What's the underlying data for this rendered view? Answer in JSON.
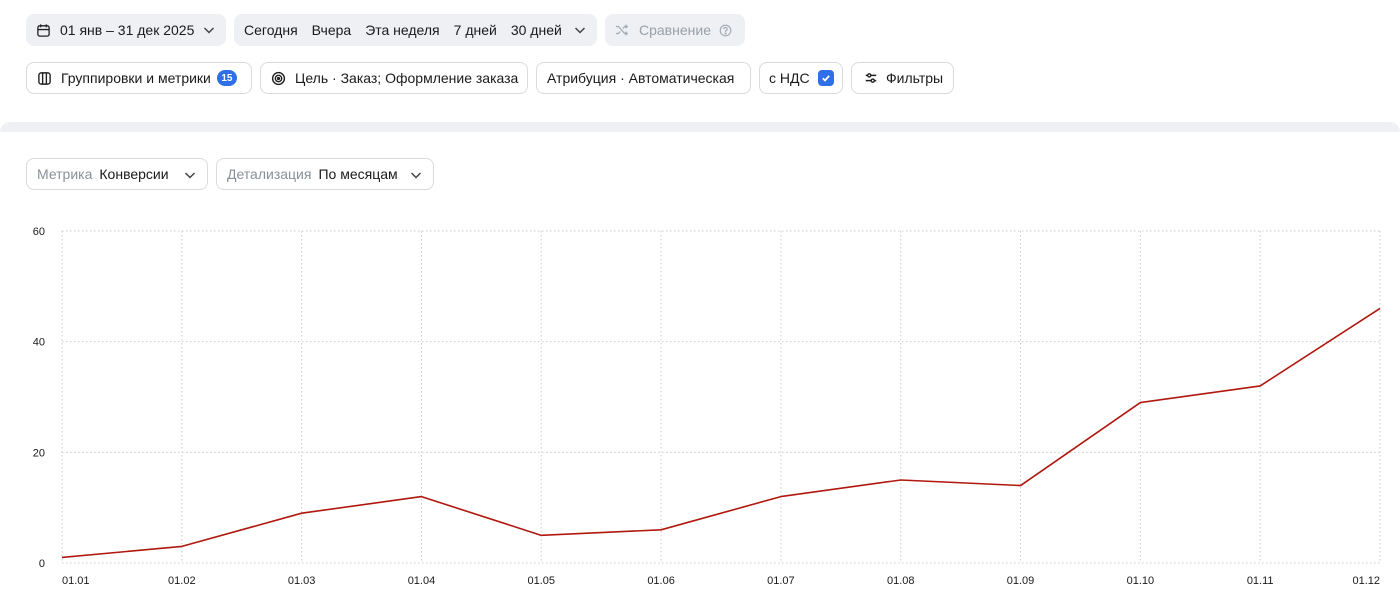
{
  "toolbar": {
    "date_range": "01 янв – 31 дек 2025",
    "quick_periods": [
      "Сегодня",
      "Вчера",
      "Эта неделя",
      "7 дней",
      "30 дней"
    ],
    "compare_label": "Сравнение",
    "groups_label": "Группировки и метрики",
    "groups_count": "15",
    "goal_label": "Цель · Заказ; Оформление заказа",
    "attribution_label": "Атрибуция · Автоматическая",
    "vat_label": "с НДС",
    "vat_checked": true,
    "filters_label": "Фильтры"
  },
  "controls": {
    "metric_label": "Метрика",
    "metric_value": "Конверсии",
    "detail_label": "Детализация",
    "detail_value": "По месяцам"
  },
  "colors": {
    "line": "#b0170d",
    "accent": "#2f6fe8",
    "grid": "#c9ccd1"
  },
  "chart_data": {
    "type": "line",
    "title": "",
    "xlabel": "",
    "ylabel": "",
    "categories": [
      "01.01",
      "01.02",
      "01.03",
      "01.04",
      "01.05",
      "01.06",
      "01.07",
      "01.08",
      "01.09",
      "01.10",
      "01.11",
      "01.12"
    ],
    "series": [
      {
        "values": [
          1,
          3,
          9,
          12,
          5,
          6,
          12,
          15,
          14,
          29,
          32,
          46
        ]
      }
    ],
    "ylim": [
      0,
      60
    ],
    "yticks": [
      0,
      20,
      40,
      60
    ],
    "grid": true,
    "legend": "none"
  }
}
